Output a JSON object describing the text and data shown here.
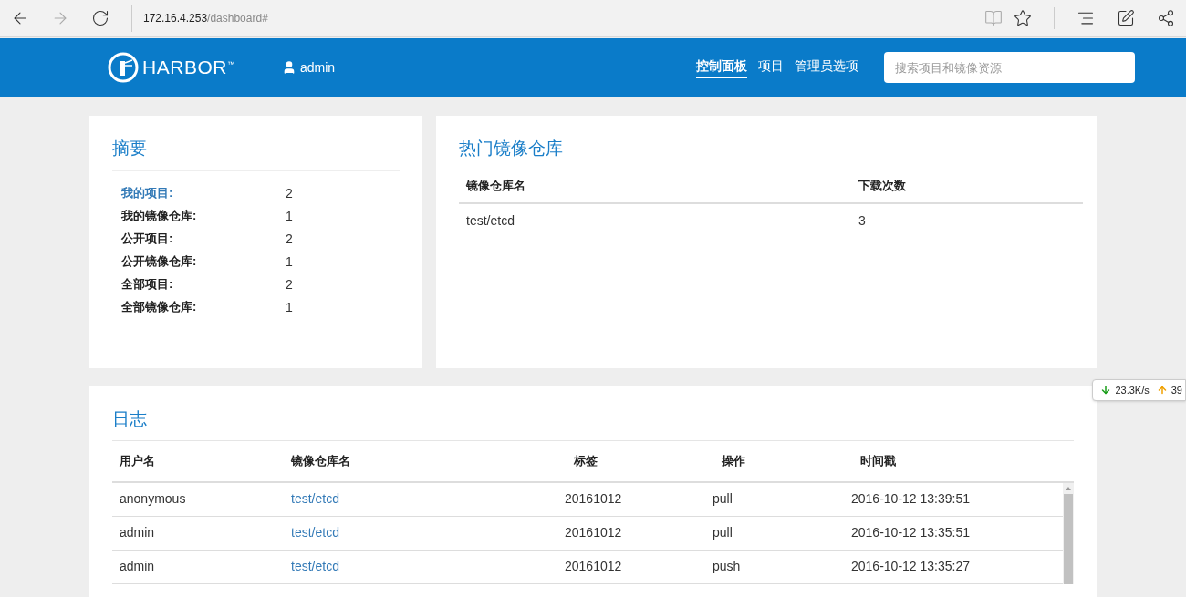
{
  "browser": {
    "address_host": "172.16.4.253",
    "address_path": "/dashboard#"
  },
  "header": {
    "logo_text": "HARBOR",
    "logo_mark": "™",
    "user": "admin",
    "nav": [
      {
        "label": "控制面板",
        "selected": true
      },
      {
        "label": "项目",
        "selected": false
      },
      {
        "label": "管理员选项",
        "selected": false
      }
    ],
    "search": {
      "placeholder": "搜索项目和镜像资源"
    }
  },
  "summary": {
    "title": "摘要",
    "items": [
      {
        "label": "我的项目:",
        "value": "2",
        "selected": true
      },
      {
        "label": "我的镜像仓库:",
        "value": "1",
        "selected": false
      },
      {
        "label": "公开项目:",
        "value": "2",
        "selected": false
      },
      {
        "label": "公开镜像仓库:",
        "value": "1",
        "selected": false
      },
      {
        "label": "全部项目:",
        "value": "2",
        "selected": false
      },
      {
        "label": "全部镜像仓库:",
        "value": "1",
        "selected": false
      }
    ]
  },
  "top_repositories": {
    "title": "热门镜像仓库",
    "columns": [
      "镜像仓库名",
      "下载次数"
    ],
    "rows": [
      [
        "test/etcd",
        "3"
      ]
    ]
  },
  "logs": {
    "title": "日志",
    "columns": [
      "用户名",
      "镜像仓库名",
      "标签",
      "操作",
      "时间戳"
    ],
    "rows": [
      [
        "anonymous",
        "test/etcd",
        "20161012",
        "pull",
        "2016-10-12 13:39:51"
      ],
      [
        "admin",
        "test/etcd",
        "20161012",
        "pull",
        "2016-10-12 13:35:51"
      ],
      [
        "admin",
        "test/etcd",
        "20161012",
        "push",
        "2016-10-12 13:35:27"
      ]
    ]
  },
  "net_speed": {
    "down": "23.3K/s",
    "up": "39"
  }
}
